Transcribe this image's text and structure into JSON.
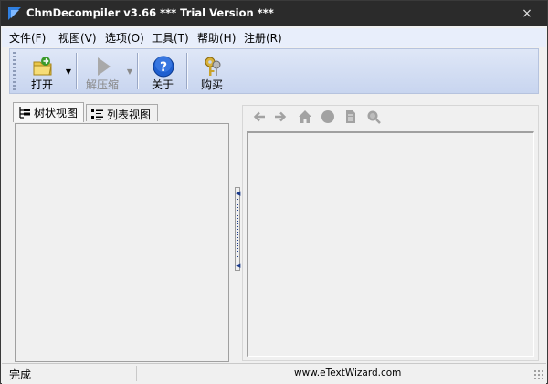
{
  "window": {
    "title": "ChmDecompiler v3.66 *** Trial Version ***",
    "close_glyph": "×"
  },
  "menu": [
    {
      "label": "文件(F)"
    },
    {
      "label": "视图(V)"
    },
    {
      "label": "选项(O)"
    },
    {
      "label": "工具(T)"
    },
    {
      "label": "帮助(H)"
    },
    {
      "label": "注册(R)"
    }
  ],
  "toolbar": {
    "open_label": "打开",
    "extract_label": "解压缩",
    "about_label": "关于",
    "buy_label": "购买",
    "dropdown_glyph": "▼"
  },
  "left_panel": {
    "tabs": [
      {
        "label": "树状视图",
        "icon": "tree-icon",
        "active": true
      },
      {
        "label": "列表视图",
        "icon": "list-icon",
        "active": false
      }
    ]
  },
  "right_panel": {
    "nav_icons": [
      "back-arrow-icon",
      "forward-arrow-icon",
      "home-icon",
      "stop-icon",
      "page-icon",
      "search-icon"
    ]
  },
  "status": {
    "left_text": "完成",
    "right_text": "www.eTextWizard.com"
  },
  "colors": {
    "titlebar": "#2b2b2b",
    "menubar": "#e8eefb",
    "toolbar": "#c8d5ef",
    "help_blue": "#1f5fd0",
    "open_green": "#3a9a2a"
  }
}
